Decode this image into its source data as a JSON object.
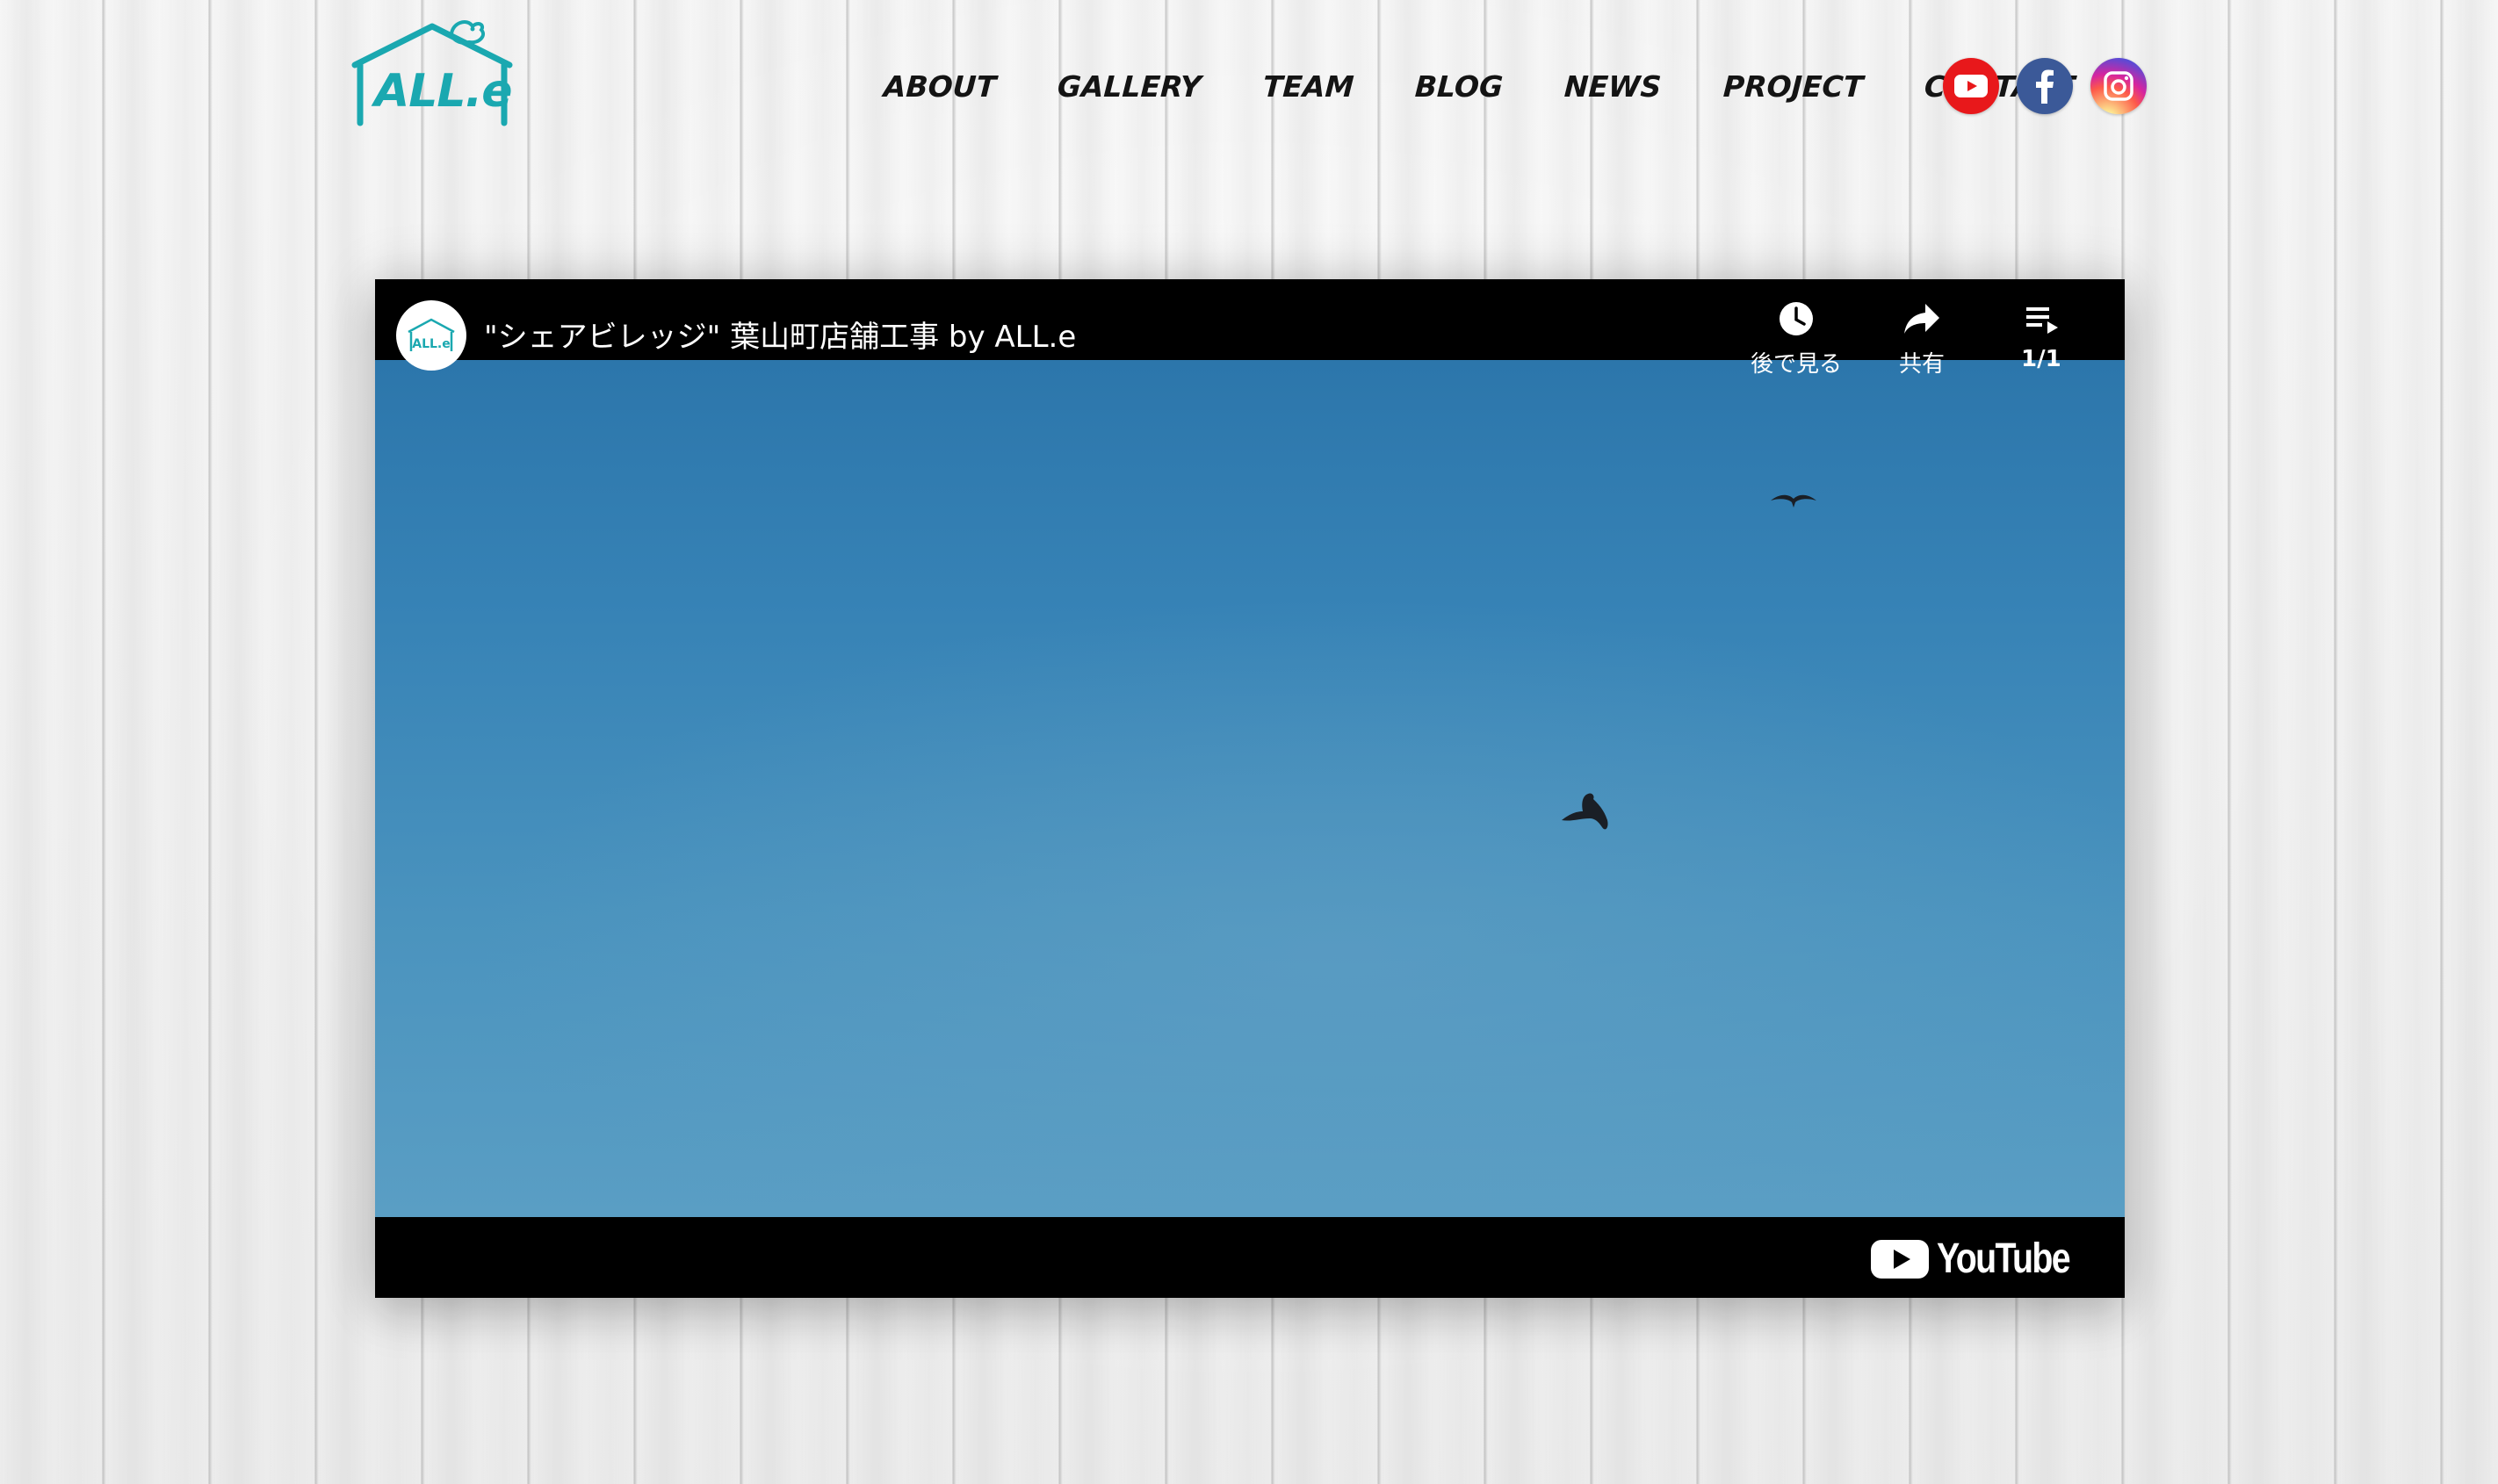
{
  "header": {
    "logo_text": "ALL.e",
    "nav": [
      {
        "label": "ABOUT"
      },
      {
        "label": "GALLERY"
      },
      {
        "label": "TEAM"
      },
      {
        "label": "BLOG"
      },
      {
        "label": "NEWS"
      },
      {
        "label": "PROJECT"
      },
      {
        "label": "CONTACT"
      }
    ],
    "social": [
      {
        "icon": "youtube-icon",
        "color": "#e8181b"
      },
      {
        "icon": "facebook-icon",
        "color": "#3b5998"
      },
      {
        "icon": "instagram-icon",
        "color": "#d6249f"
      }
    ]
  },
  "video": {
    "title": "\"シェアビレッジ\" 葉山町店舗工事 by ALL.e",
    "channel_avatar_text": "ALL.e",
    "actions": {
      "watch_later_label": "後で見る",
      "share_label": "共有",
      "playlist_label": "1/1"
    },
    "platform_logo_text": "YouTube"
  },
  "colors": {
    "brand_teal": "#1aa8b0",
    "sky_blue": "#3783b6"
  }
}
